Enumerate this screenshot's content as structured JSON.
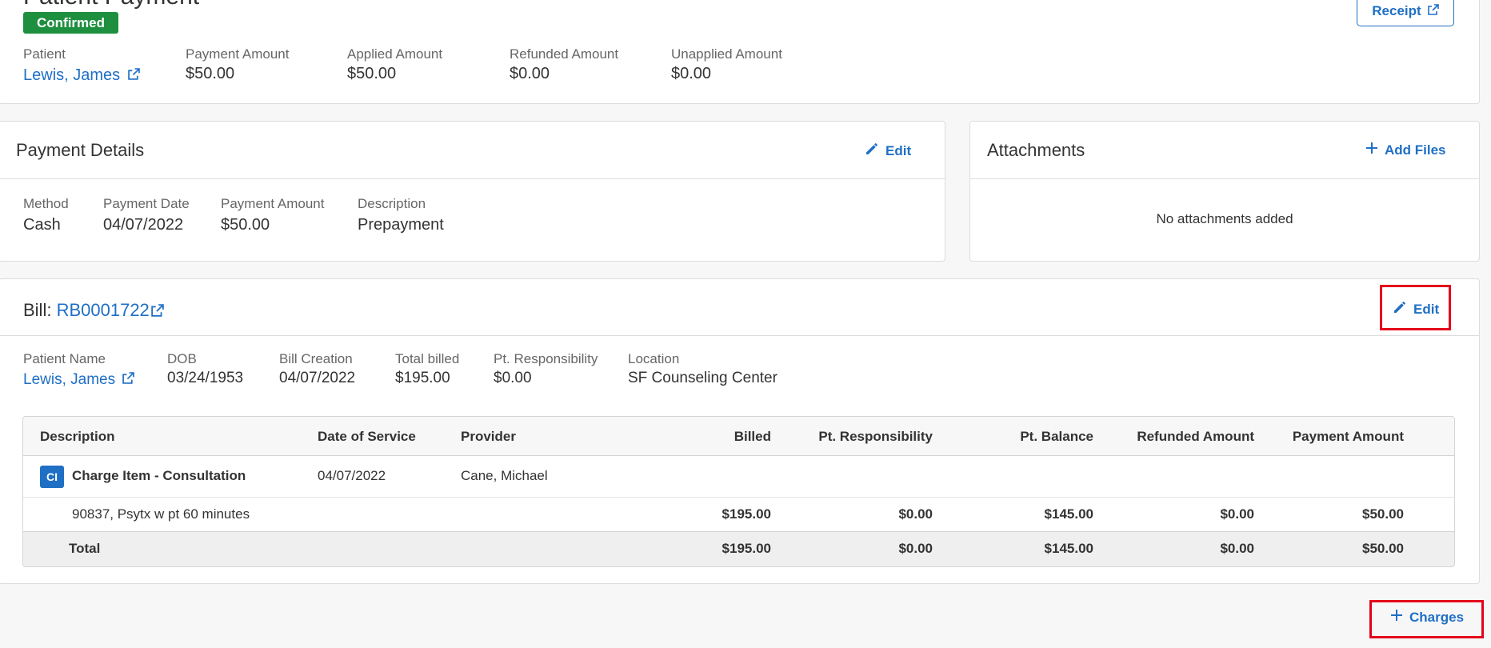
{
  "header": {
    "title": "Patient Payment",
    "status": "Confirmed",
    "receipt_label": "Receipt",
    "patient_label": "Patient",
    "patient_name": "Lewis, James",
    "payment_amount_label": "Payment Amount",
    "payment_amount": "$50.00",
    "applied_amount_label": "Applied Amount",
    "applied_amount": "$50.00",
    "refunded_amount_label": "Refunded Amount",
    "refunded_amount": "$0.00",
    "unapplied_amount_label": "Unapplied Amount",
    "unapplied_amount": "$0.00"
  },
  "payment_details": {
    "title": "Payment Details",
    "edit_label": "Edit",
    "method_label": "Method",
    "method": "Cash",
    "date_label": "Payment Date",
    "date": "04/07/2022",
    "amount_label": "Payment Amount",
    "amount": "$50.00",
    "description_label": "Description",
    "description": "Prepayment"
  },
  "attachments": {
    "title": "Attachments",
    "add_label": "Add Files",
    "empty_text": "No attachments added"
  },
  "bill": {
    "prefix": "Bill:",
    "number": "RB0001722",
    "edit_label": "Edit",
    "patient_name_label": "Patient Name",
    "patient_name": "Lewis, James",
    "dob_label": "DOB",
    "dob": "03/24/1953",
    "creation_label": "Bill Creation",
    "creation": "04/07/2022",
    "total_billed_label": "Total billed",
    "total_billed": "$195.00",
    "pt_resp_label": "Pt. Responsibility",
    "pt_resp": "$0.00",
    "location_label": "Location",
    "location": "SF Counseling Center"
  },
  "table": {
    "headers": [
      "Description",
      "Date of Service",
      "Provider",
      "Billed",
      "Pt. Responsibility",
      "Pt. Balance",
      "Refunded Amount",
      "Payment Amount"
    ],
    "charge": {
      "badge": "CI",
      "description": "Charge Item - Consultation",
      "date": "04/07/2022",
      "provider": "Cane, Michael"
    },
    "line": {
      "description": "90837, Psytx w pt 60 minutes",
      "billed": "$195.00",
      "pt_resp": "$0.00",
      "pt_balance": "$145.00",
      "refunded": "$0.00",
      "payment": "$50.00"
    },
    "total": {
      "label": "Total",
      "billed": "$195.00",
      "pt_resp": "$0.00",
      "pt_balance": "$145.00",
      "refunded": "$0.00",
      "payment": "$50.00"
    }
  },
  "footer": {
    "charges_label": "Charges"
  },
  "colors": {
    "accent": "#1f6fc5",
    "confirmed_badge": "#1e8f3e",
    "highlight": "#e4001b"
  }
}
